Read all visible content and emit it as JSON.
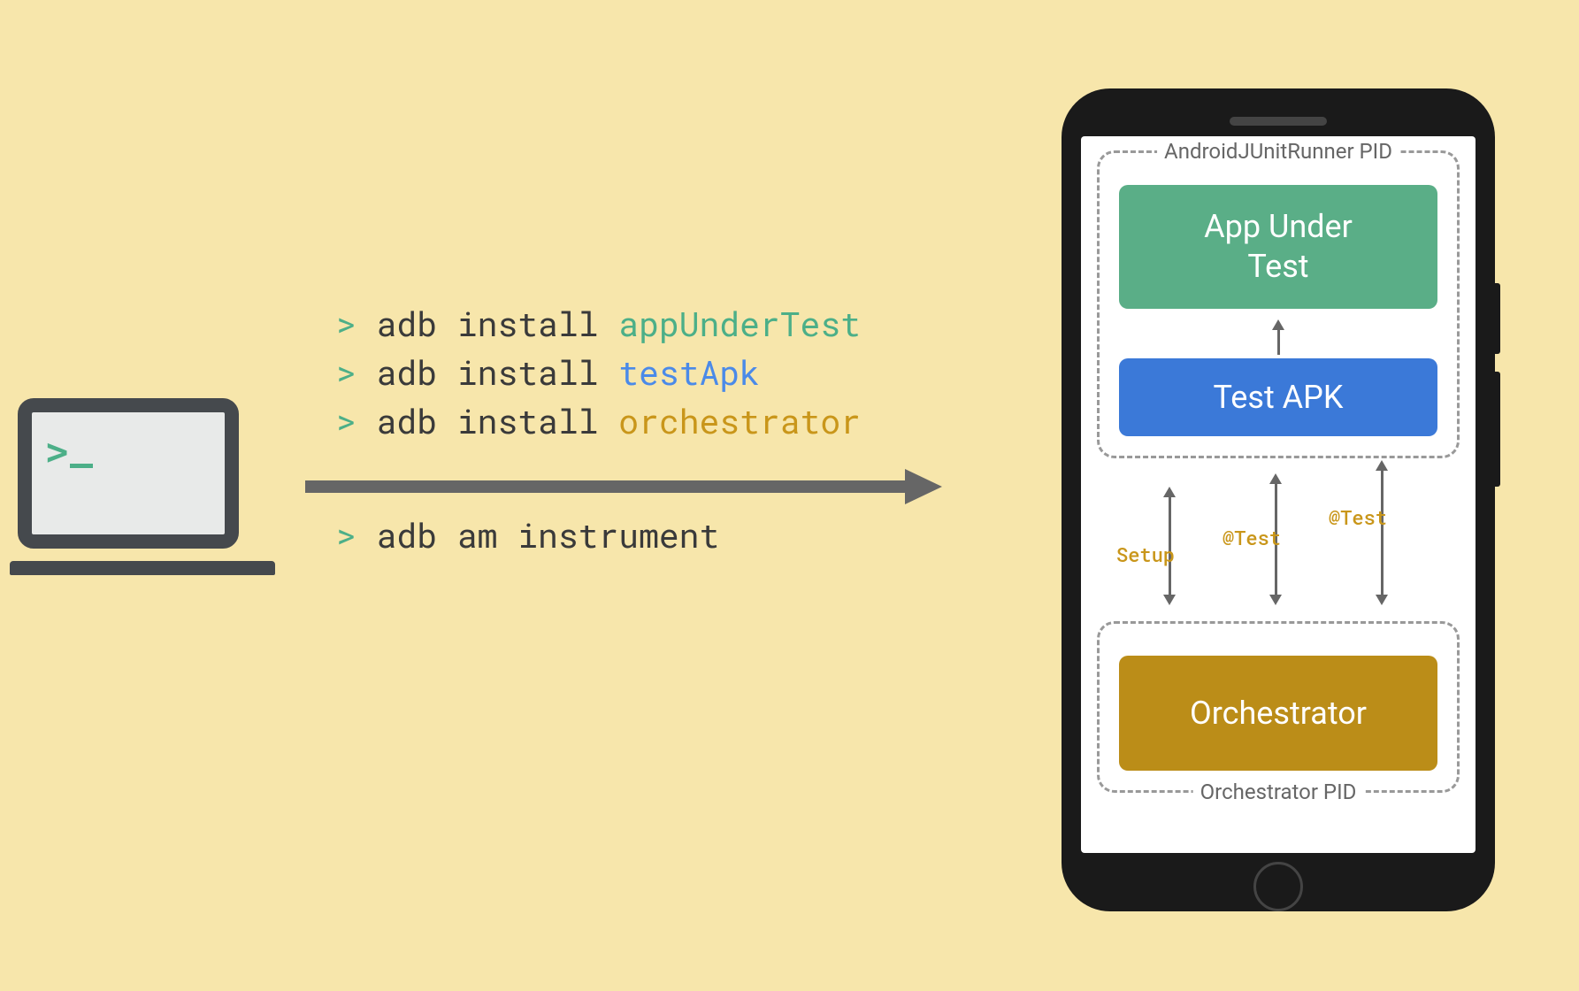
{
  "terminal": {
    "prompt": ">",
    "lines": [
      {
        "prompt": ">",
        "cmd": "adb install",
        "arg": "appUnderTest",
        "argClass": "arg-green"
      },
      {
        "prompt": ">",
        "cmd": "adb install",
        "arg": "testApk",
        "argClass": "arg-blue"
      },
      {
        "prompt": ">",
        "cmd": "adb install",
        "arg": "orchestrator",
        "argClass": "arg-yellow"
      }
    ],
    "instrument": {
      "prompt": ">",
      "cmd": "adb am instrument"
    }
  },
  "phone": {
    "pid_top_label": "AndroidJUnitRunner PID",
    "pid_bottom_label": "Orchestrator PID",
    "box_app": "App Under\nTest",
    "box_testapk": "Test APK",
    "box_orchestrator": "Orchestrator",
    "arrows": {
      "label_setup": "Setup",
      "label_test1": "@Test",
      "label_test2": "@Test"
    }
  }
}
